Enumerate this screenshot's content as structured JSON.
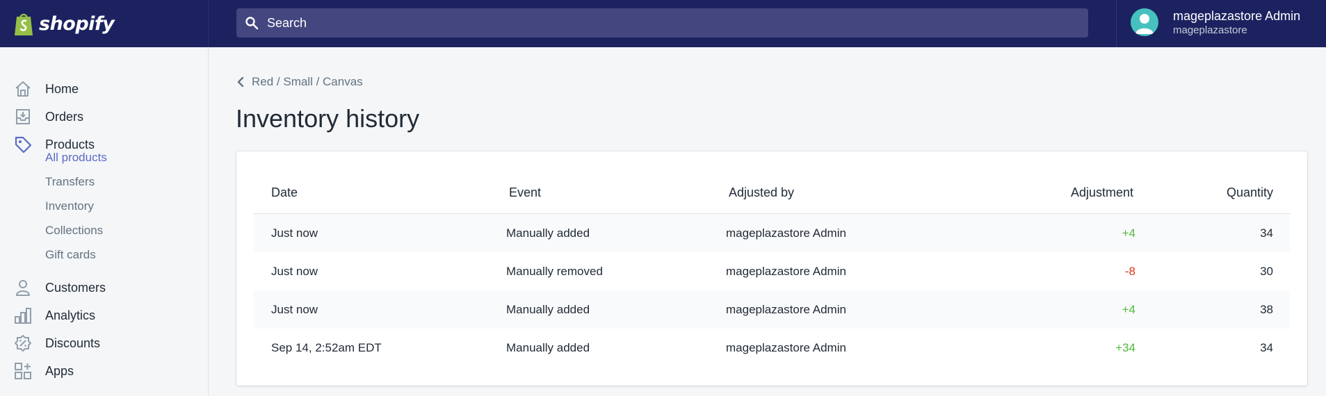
{
  "brand": {
    "name": "shopify"
  },
  "search": {
    "placeholder": "Search"
  },
  "user": {
    "name": "mageplazastore Admin",
    "store": "mageplazastore"
  },
  "sidebar": {
    "items": [
      {
        "label": "Home",
        "icon": "home-icon"
      },
      {
        "label": "Orders",
        "icon": "orders-icon"
      },
      {
        "label": "Products",
        "icon": "tag-icon"
      },
      {
        "label": "Customers",
        "icon": "customers-icon"
      },
      {
        "label": "Analytics",
        "icon": "analytics-icon"
      },
      {
        "label": "Discounts",
        "icon": "discounts-icon"
      },
      {
        "label": "Apps",
        "icon": "apps-icon"
      }
    ],
    "product_subitems": [
      {
        "label": "All products",
        "active": true
      },
      {
        "label": "Transfers",
        "active": false
      },
      {
        "label": "Inventory",
        "active": false
      },
      {
        "label": "Collections",
        "active": false
      },
      {
        "label": "Gift cards",
        "active": false
      }
    ]
  },
  "breadcrumb": {
    "label": "Red / Small / Canvas"
  },
  "page": {
    "title": "Inventory history"
  },
  "table": {
    "headers": {
      "date": "Date",
      "event": "Event",
      "adjusted_by": "Adjusted by",
      "adjustment": "Adjustment",
      "quantity": "Quantity"
    },
    "rows": [
      {
        "date": "Just now",
        "event": "Manually added",
        "adjusted_by": "mageplazastore Admin",
        "adjustment": "+4",
        "quantity": "34"
      },
      {
        "date": "Just now",
        "event": "Manually removed",
        "adjusted_by": "mageplazastore Admin",
        "adjustment": "-8",
        "quantity": "30"
      },
      {
        "date": "Just now",
        "event": "Manually added",
        "adjusted_by": "mageplazastore Admin",
        "adjustment": "+4",
        "quantity": "38"
      },
      {
        "date": "Sep 14, 2:52am EDT",
        "event": "Manually added",
        "adjusted_by": "mageplazastore Admin",
        "adjustment": "+34",
        "quantity": "34"
      }
    ]
  },
  "colors": {
    "topbar": "#1c2260",
    "accent": "#5c6ac4",
    "positive": "#50b83c",
    "negative": "#de3618"
  }
}
